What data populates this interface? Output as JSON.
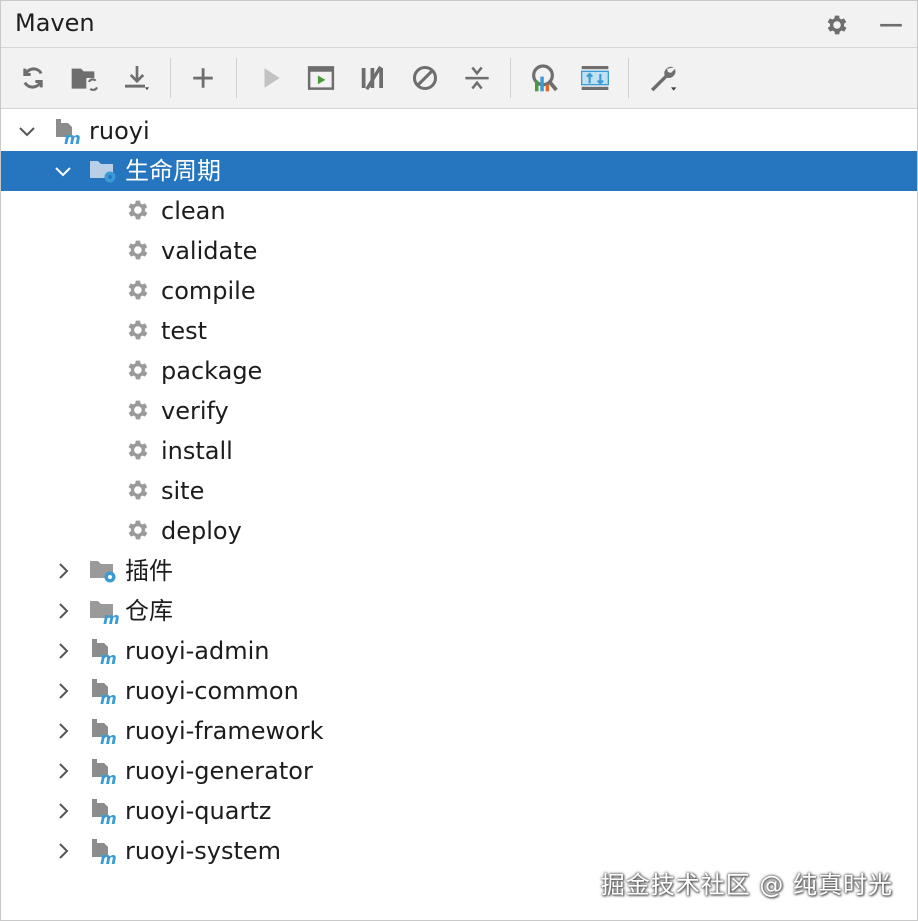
{
  "panel": {
    "title": "Maven"
  },
  "colors": {
    "selection": "#2675bf",
    "maven_blue": "#3b9bd6",
    "icon_gray": "#6e6e6e",
    "run_green": "#4a9a3a"
  },
  "toolbar": {
    "items": [
      {
        "icon": "reload-icon"
      },
      {
        "icon": "generate-sources-icon"
      },
      {
        "icon": "download-icon"
      },
      {
        "icon": "add-icon"
      },
      {
        "icon": "run-icon"
      },
      {
        "icon": "run-config-icon"
      },
      {
        "icon": "toggle-offline-icon"
      },
      {
        "icon": "skip-tests-icon"
      },
      {
        "icon": "collapse-all-icon"
      },
      {
        "icon": "analyze-dependencies-icon"
      },
      {
        "icon": "show-diagram-icon"
      },
      {
        "icon": "settings-wrench-icon"
      }
    ]
  },
  "tree": {
    "root": "ruoyi",
    "lifecycle": "生命周期",
    "phases": [
      "clean",
      "validate",
      "compile",
      "test",
      "package",
      "verify",
      "install",
      "site",
      "deploy"
    ],
    "plugins": "插件",
    "repositories": "仓库",
    "modules": [
      "ruoyi-admin",
      "ruoyi-common",
      "ruoyi-framework",
      "ruoyi-generator",
      "ruoyi-quartz",
      "ruoyi-system"
    ]
  },
  "watermark": "掘金技术社区 @ 纯真时光"
}
